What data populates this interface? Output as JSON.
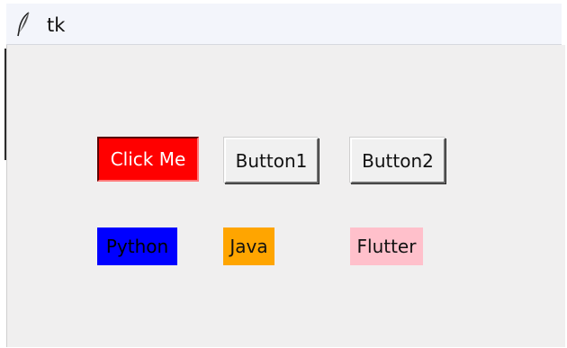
{
  "window": {
    "title": "tk",
    "icon": "feather-icon"
  },
  "buttons": {
    "click_me": "Click Me",
    "button1": "Button1",
    "button2": "Button2"
  },
  "labels": {
    "python": "Python",
    "java": "Java",
    "flutter": "Flutter"
  },
  "colors": {
    "click_me_bg": "#ff0000",
    "click_me_fg": "#ffffff",
    "python_bg": "#0000ff",
    "python_fg": "#000000",
    "java_bg": "#ffa500",
    "flutter_bg": "#ffc0cb",
    "window_bg": "#f0efef"
  }
}
